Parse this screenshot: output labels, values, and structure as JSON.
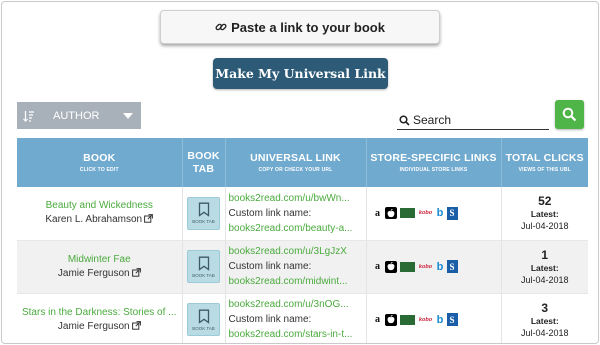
{
  "paste_button": {
    "label": "Paste a link to your book"
  },
  "make_button": {
    "label": "Make My Universal Link"
  },
  "sort": {
    "selected": "AUTHOR"
  },
  "search": {
    "placeholder": "Search"
  },
  "columns": {
    "book": {
      "title": "BOOK",
      "sub": "CLICK TO EDIT"
    },
    "book_tab": {
      "title1": "BOOK",
      "title2": "TAB"
    },
    "universal_link": {
      "title": "UNIVERSAL LINK",
      "sub": "COPY OR CHECK YOUR URL"
    },
    "store_links": {
      "title": "STORE-SPECIFIC LINKS",
      "sub": "INDIVIDUAL STORE LINKS"
    },
    "total_clicks": {
      "title": "TOTAL CLICKS",
      "sub": "VIEWS OF THIS UBL"
    }
  },
  "book_tab_label": "BOOK TAB",
  "custom_link_label": "Custom link name:",
  "latest_label": "Latest:",
  "store_icons": [
    "amazon-icon",
    "apple-books-icon",
    "google-play-icon",
    "kobo-icon",
    "nook-icon",
    "scribd-icon"
  ],
  "rows": [
    {
      "title": "Beauty and Wickedness",
      "author": "Karen L. Abrahamson",
      "link": "books2read.com/u/bwWn...",
      "custom": "books2read.com/beauty-a...",
      "clicks": "52",
      "latest": "Jul-04-2018"
    },
    {
      "title": "Midwinter Fae",
      "author": "Jamie Ferguson",
      "link": "books2read.com/u/3LgJzX",
      "custom": "books2read.com/midwint...",
      "clicks": "1",
      "latest": "Jul-04-2018"
    },
    {
      "title": "Stars in the Darkness: Stories of ...",
      "author": "Jamie Ferguson",
      "link": "books2read.com/u/3nOG...",
      "custom": "books2read.com/stars-in-t...",
      "clicks": "3",
      "latest": "Jul-04-2018"
    }
  ],
  "colors": {
    "header": "#71aacf",
    "link_green": "#4aaa3d",
    "make_button": "#2d5b77",
    "search_button": "#4fb548"
  }
}
